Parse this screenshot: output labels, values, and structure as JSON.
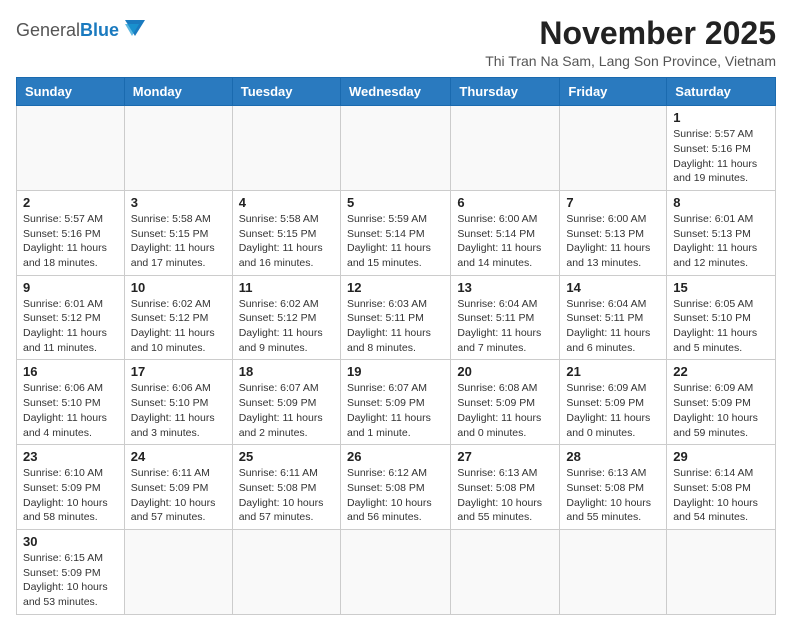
{
  "header": {
    "logo_general": "General",
    "logo_blue": "Blue",
    "month_title": "November 2025",
    "location": "Thi Tran Na Sam, Lang Son Province, Vietnam"
  },
  "days_of_week": [
    "Sunday",
    "Monday",
    "Tuesday",
    "Wednesday",
    "Thursday",
    "Friday",
    "Saturday"
  ],
  "weeks": [
    [
      {
        "day": "",
        "info": ""
      },
      {
        "day": "",
        "info": ""
      },
      {
        "day": "",
        "info": ""
      },
      {
        "day": "",
        "info": ""
      },
      {
        "day": "",
        "info": ""
      },
      {
        "day": "",
        "info": ""
      },
      {
        "day": "1",
        "info": "Sunrise: 5:57 AM\nSunset: 5:16 PM\nDaylight: 11 hours\nand 19 minutes."
      }
    ],
    [
      {
        "day": "2",
        "info": "Sunrise: 5:57 AM\nSunset: 5:16 PM\nDaylight: 11 hours\nand 18 minutes."
      },
      {
        "day": "3",
        "info": "Sunrise: 5:58 AM\nSunset: 5:15 PM\nDaylight: 11 hours\nand 17 minutes."
      },
      {
        "day": "4",
        "info": "Sunrise: 5:58 AM\nSunset: 5:15 PM\nDaylight: 11 hours\nand 16 minutes."
      },
      {
        "day": "5",
        "info": "Sunrise: 5:59 AM\nSunset: 5:14 PM\nDaylight: 11 hours\nand 15 minutes."
      },
      {
        "day": "6",
        "info": "Sunrise: 6:00 AM\nSunset: 5:14 PM\nDaylight: 11 hours\nand 14 minutes."
      },
      {
        "day": "7",
        "info": "Sunrise: 6:00 AM\nSunset: 5:13 PM\nDaylight: 11 hours\nand 13 minutes."
      },
      {
        "day": "8",
        "info": "Sunrise: 6:01 AM\nSunset: 5:13 PM\nDaylight: 11 hours\nand 12 minutes."
      }
    ],
    [
      {
        "day": "9",
        "info": "Sunrise: 6:01 AM\nSunset: 5:12 PM\nDaylight: 11 hours\nand 11 minutes."
      },
      {
        "day": "10",
        "info": "Sunrise: 6:02 AM\nSunset: 5:12 PM\nDaylight: 11 hours\nand 10 minutes."
      },
      {
        "day": "11",
        "info": "Sunrise: 6:02 AM\nSunset: 5:12 PM\nDaylight: 11 hours\nand 9 minutes."
      },
      {
        "day": "12",
        "info": "Sunrise: 6:03 AM\nSunset: 5:11 PM\nDaylight: 11 hours\nand 8 minutes."
      },
      {
        "day": "13",
        "info": "Sunrise: 6:04 AM\nSunset: 5:11 PM\nDaylight: 11 hours\nand 7 minutes."
      },
      {
        "day": "14",
        "info": "Sunrise: 6:04 AM\nSunset: 5:11 PM\nDaylight: 11 hours\nand 6 minutes."
      },
      {
        "day": "15",
        "info": "Sunrise: 6:05 AM\nSunset: 5:10 PM\nDaylight: 11 hours\nand 5 minutes."
      }
    ],
    [
      {
        "day": "16",
        "info": "Sunrise: 6:06 AM\nSunset: 5:10 PM\nDaylight: 11 hours\nand 4 minutes."
      },
      {
        "day": "17",
        "info": "Sunrise: 6:06 AM\nSunset: 5:10 PM\nDaylight: 11 hours\nand 3 minutes."
      },
      {
        "day": "18",
        "info": "Sunrise: 6:07 AM\nSunset: 5:09 PM\nDaylight: 11 hours\nand 2 minutes."
      },
      {
        "day": "19",
        "info": "Sunrise: 6:07 AM\nSunset: 5:09 PM\nDaylight: 11 hours\nand 1 minute."
      },
      {
        "day": "20",
        "info": "Sunrise: 6:08 AM\nSunset: 5:09 PM\nDaylight: 11 hours\nand 0 minutes."
      },
      {
        "day": "21",
        "info": "Sunrise: 6:09 AM\nSunset: 5:09 PM\nDaylight: 11 hours\nand 0 minutes."
      },
      {
        "day": "22",
        "info": "Sunrise: 6:09 AM\nSunset: 5:09 PM\nDaylight: 10 hours\nand 59 minutes."
      }
    ],
    [
      {
        "day": "23",
        "info": "Sunrise: 6:10 AM\nSunset: 5:09 PM\nDaylight: 10 hours\nand 58 minutes."
      },
      {
        "day": "24",
        "info": "Sunrise: 6:11 AM\nSunset: 5:09 PM\nDaylight: 10 hours\nand 57 minutes."
      },
      {
        "day": "25",
        "info": "Sunrise: 6:11 AM\nSunset: 5:08 PM\nDaylight: 10 hours\nand 57 minutes."
      },
      {
        "day": "26",
        "info": "Sunrise: 6:12 AM\nSunset: 5:08 PM\nDaylight: 10 hours\nand 56 minutes."
      },
      {
        "day": "27",
        "info": "Sunrise: 6:13 AM\nSunset: 5:08 PM\nDaylight: 10 hours\nand 55 minutes."
      },
      {
        "day": "28",
        "info": "Sunrise: 6:13 AM\nSunset: 5:08 PM\nDaylight: 10 hours\nand 55 minutes."
      },
      {
        "day": "29",
        "info": "Sunrise: 6:14 AM\nSunset: 5:08 PM\nDaylight: 10 hours\nand 54 minutes."
      }
    ],
    [
      {
        "day": "30",
        "info": "Sunrise: 6:15 AM\nSunset: 5:09 PM\nDaylight: 10 hours\nand 53 minutes."
      },
      {
        "day": "",
        "info": ""
      },
      {
        "day": "",
        "info": ""
      },
      {
        "day": "",
        "info": ""
      },
      {
        "day": "",
        "info": ""
      },
      {
        "day": "",
        "info": ""
      },
      {
        "day": "",
        "info": ""
      }
    ]
  ]
}
